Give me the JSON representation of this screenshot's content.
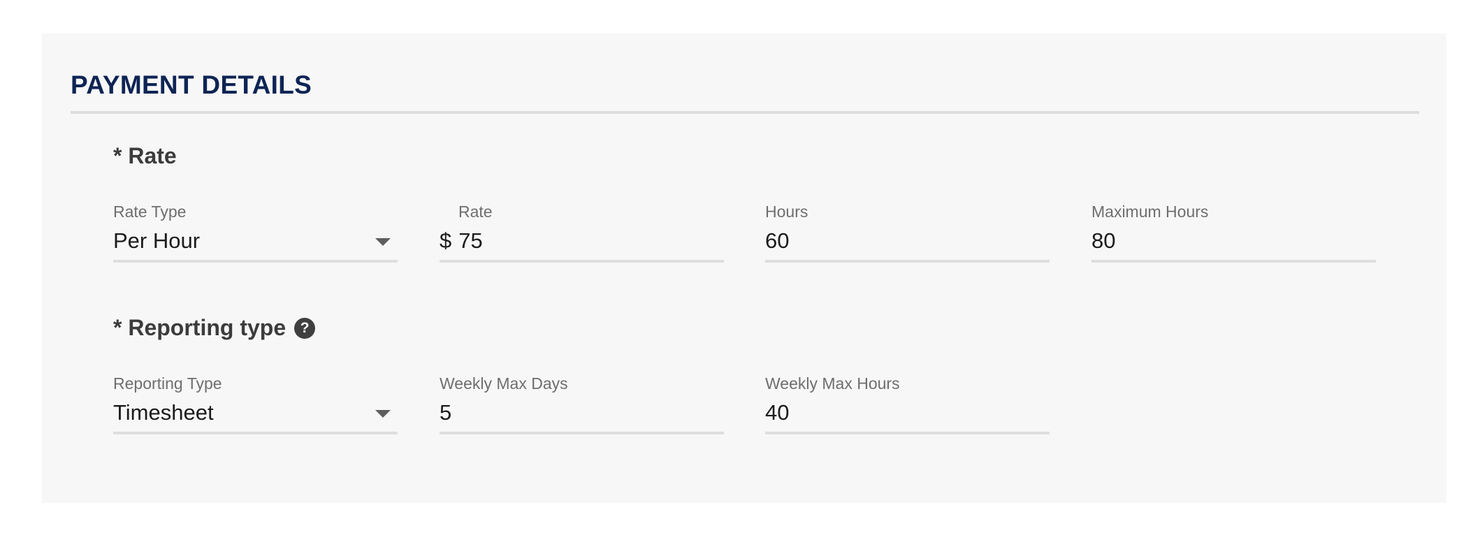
{
  "section": {
    "title": "PAYMENT DETAILS"
  },
  "rate_group": {
    "heading": "* Rate",
    "rate_type": {
      "label": "Rate Type",
      "value": "Per Hour"
    },
    "rate": {
      "label": "Rate",
      "prefix": "$",
      "value": "75"
    },
    "hours": {
      "label": "Hours",
      "value": "60"
    },
    "max_hours": {
      "label": "Maximum Hours",
      "value": "80"
    }
  },
  "reporting_group": {
    "heading": "* Reporting type",
    "help_icon": {
      "glyph": "?",
      "name": "help-icon"
    },
    "reporting_type": {
      "label": "Reporting Type",
      "value": "Timesheet"
    },
    "weekly_max_days": {
      "label": "Weekly Max Days",
      "value": "5"
    },
    "weekly_max_hours": {
      "label": "Weekly Max Hours",
      "value": "40"
    }
  },
  "colors": {
    "title": "#0d2454",
    "panel_bg": "#f7f7f7",
    "underline": "#dedede",
    "label": "#6e6e6e",
    "value": "#1b1b1b"
  }
}
